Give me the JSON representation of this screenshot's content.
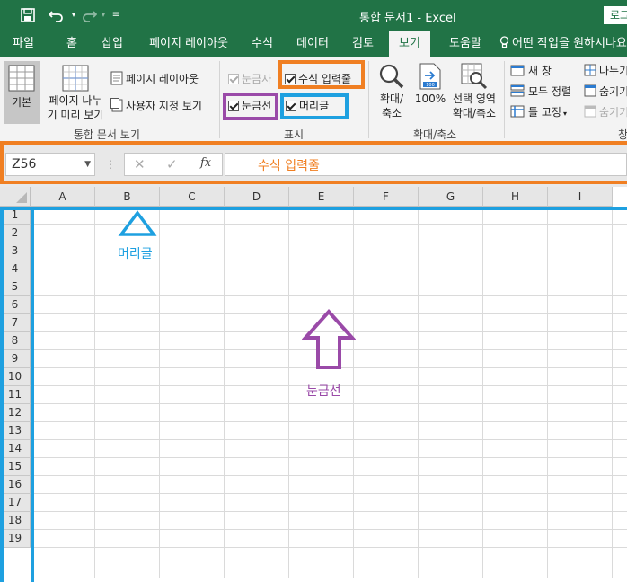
{
  "title_bar": {
    "title": "통합 문서1  -  Excel",
    "login_label": "로그",
    "save_icon": "save-icon",
    "undo_icon": "undo-icon",
    "redo_icon": "redo-icon",
    "customize_icon": "customize-icon"
  },
  "tabs": [
    "파일",
    "홈",
    "삽입",
    "페이지 레이아웃",
    "수식",
    "데이터",
    "검토",
    "보기",
    "도움말"
  ],
  "active_tab": "보기",
  "tell_me": "어떤 작업을 원하시나요",
  "ribbon": {
    "workbook_views": {
      "normal": "기본",
      "page_break_1": "페이지 나누",
      "page_break_2": "기 미리 보기",
      "page_layout": "페이지 레이아웃",
      "custom_views": "사용자 지정 보기",
      "group_label": "통합 문서 보기"
    },
    "show": {
      "ruler": "눈금자",
      "formula_bar": "수식 입력줄",
      "gridlines": "눈금선",
      "headings": "머리글",
      "group_label": "표시"
    },
    "zoom": {
      "zoom_1": "확대/",
      "zoom_2": "축소",
      "hundred": "100%",
      "selection_1": "선택 영역",
      "selection_2": "확대/축소",
      "group_label": "확대/축소"
    },
    "window": {
      "new_window": "새 창",
      "arrange_all": "모두 정렬",
      "freeze": "틀 고정",
      "split": "나누기",
      "hide": "숨기기",
      "unhide": "숨기기",
      "group_label": "창"
    }
  },
  "formula_bar": {
    "name_box": "Z56",
    "fx": "fx"
  },
  "annotations": {
    "formula_bar_label": "수식 입력줄",
    "headings_label": "머리글",
    "gridlines_label": "눈금선"
  },
  "colors": {
    "excel_green": "#217346",
    "orange": "#f07f22",
    "purple": "#9a4aa8",
    "blue": "#1ea0e0"
  },
  "grid": {
    "columns": [
      "A",
      "B",
      "C",
      "D",
      "E",
      "F",
      "G",
      "H",
      "I"
    ],
    "rows": [
      "1",
      "2",
      "3",
      "4",
      "5",
      "6",
      "7",
      "8",
      "9",
      "10",
      "11",
      "12",
      "13",
      "14",
      "15",
      "16",
      "17",
      "18",
      "19"
    ]
  }
}
